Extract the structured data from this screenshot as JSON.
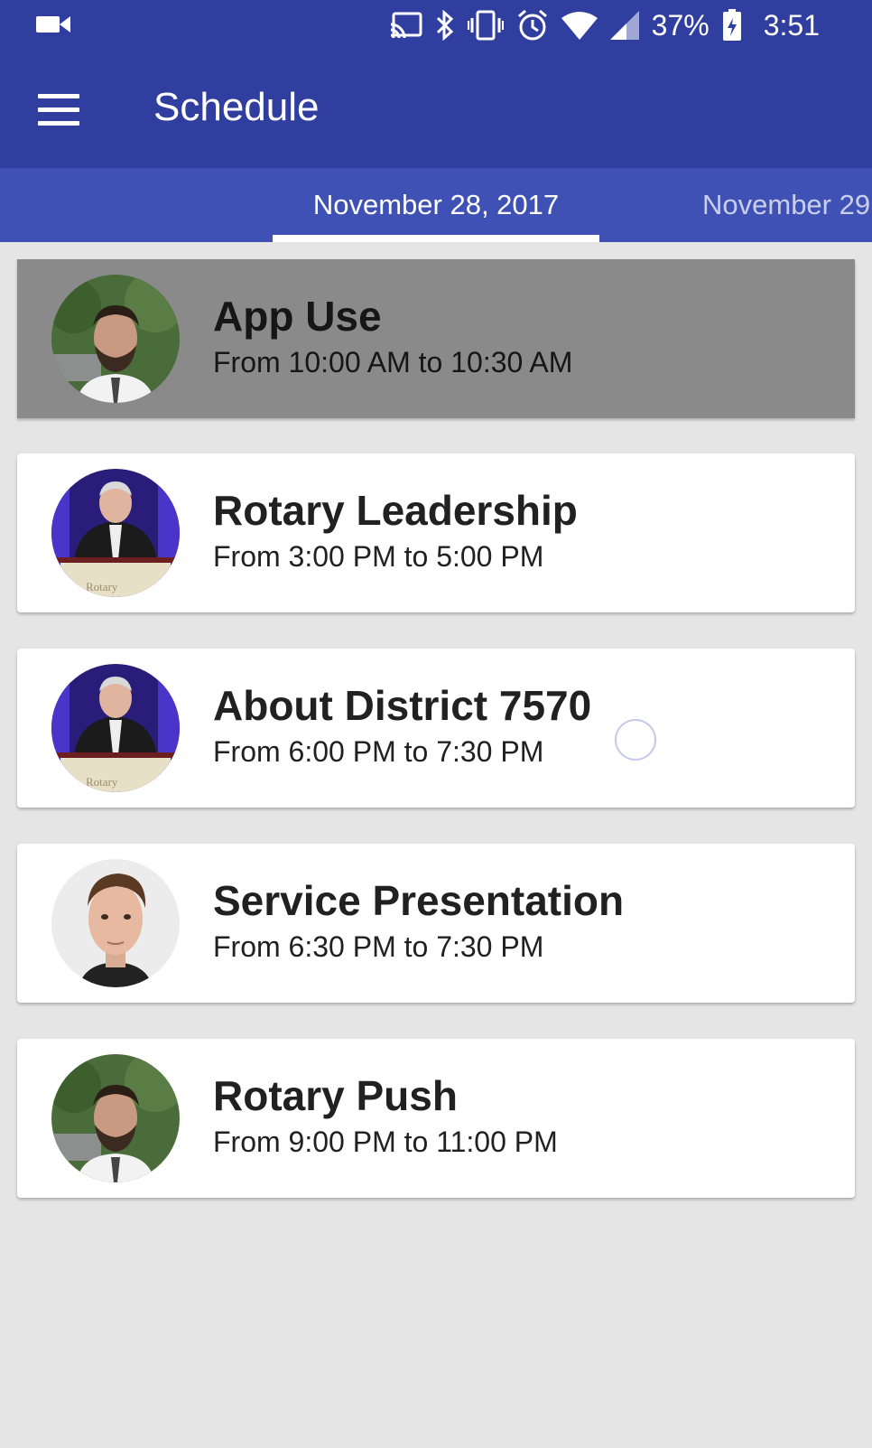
{
  "status_bar": {
    "battery": "37%",
    "time": "3:51"
  },
  "app_bar": {
    "title": "Schedule"
  },
  "tabs": [
    {
      "label": "November 28, 2017",
      "active": true
    },
    {
      "label": "November 29",
      "active": false
    }
  ],
  "colors": {
    "primary": "#303f9f",
    "tabs": "#3f51b5",
    "background": "#e5e5e5",
    "selected_card": "#8a8a8a"
  },
  "events": [
    {
      "title": "App Use",
      "time": "From 10:00 AM to 10:30 AM",
      "selected": true,
      "avatar": "speaker-photo-bearded-man"
    },
    {
      "title": "Rotary Leadership",
      "time": "From 3:00 PM to 5:00 PM",
      "selected": false,
      "avatar": "speaker-photo-podium"
    },
    {
      "title": "About District 7570",
      "time": "From 6:00 PM to 7:30 PM",
      "selected": false,
      "avatar": "speaker-photo-podium"
    },
    {
      "title": "Service Presentation",
      "time": "From 6:30 PM to 7:30 PM",
      "selected": false,
      "avatar": "speaker-photo-young-man"
    },
    {
      "title": "Rotary Push",
      "time": "From 9:00 PM to 11:00 PM",
      "selected": false,
      "avatar": "speaker-photo-bearded-man"
    }
  ]
}
